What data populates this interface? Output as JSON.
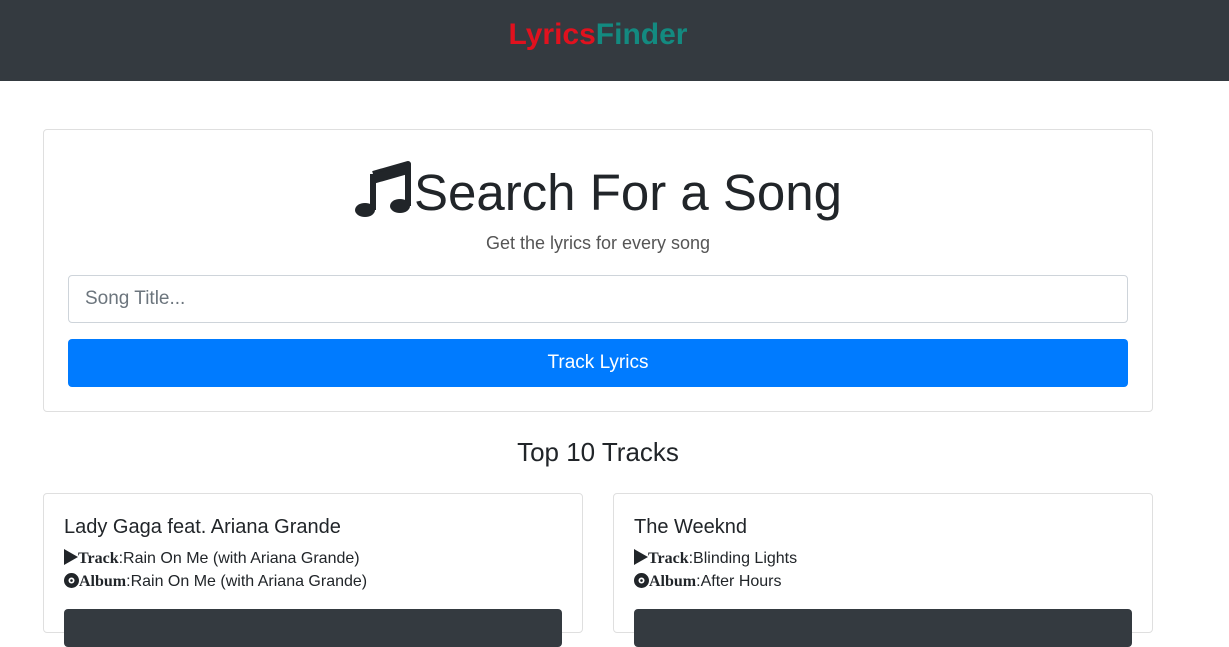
{
  "navbar": {
    "brand_part1": "Lyrics",
    "brand_part2": "Finder",
    "brand_colors": {
      "part1": "#e1111e",
      "part2": "#138a80"
    },
    "background": "#343a40"
  },
  "search": {
    "title": "Search For a Song",
    "title_icon": "music-note-icon",
    "subtitle": "Get the lyrics for every song",
    "input_placeholder": "Song Title...",
    "input_value": "",
    "button_label": "Track Lyrics",
    "button_color": "#007bff"
  },
  "top_tracks": {
    "heading": "Top 10 Tracks",
    "track_label": "Track",
    "album_label": "Album",
    "items": [
      {
        "artist": "Lady Gaga feat. Ariana Grande",
        "track": "Rain On Me (with Ariana Grande)",
        "album": "Rain On Me (with Ariana Grande)"
      },
      {
        "artist": "The Weeknd",
        "track": "Blinding Lights",
        "album": "After Hours"
      }
    ]
  }
}
